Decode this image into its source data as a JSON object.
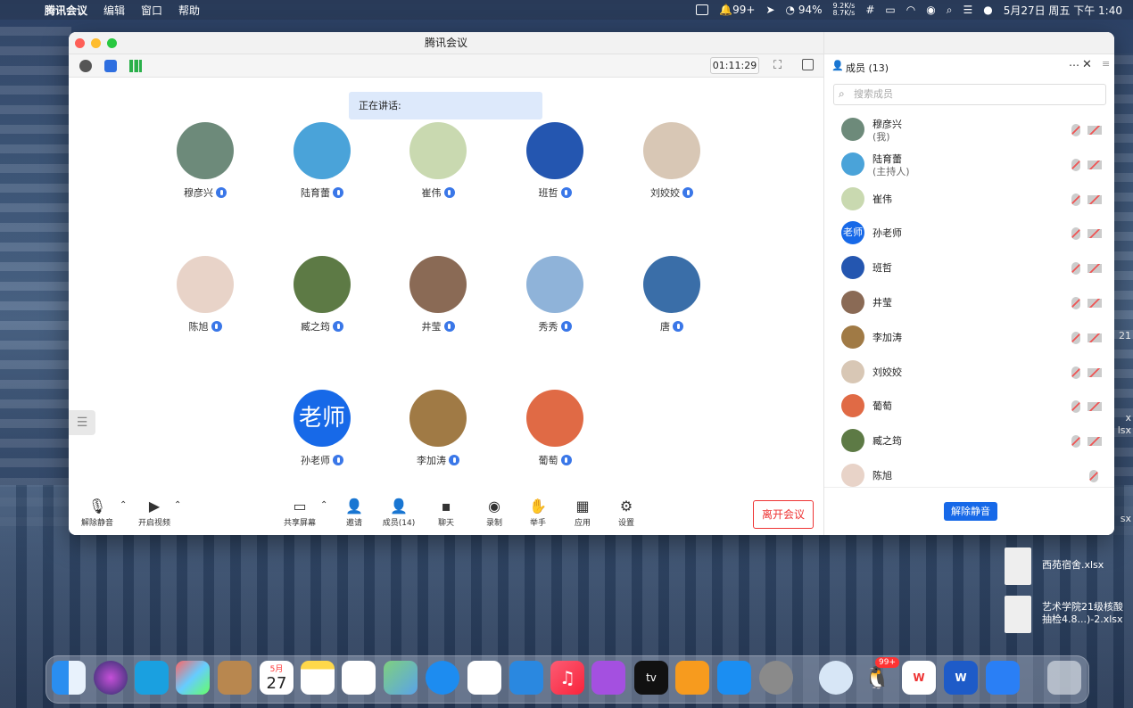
{
  "menubar": {
    "app": "腾讯会议",
    "items": [
      "编辑",
      "窗口",
      "帮助"
    ],
    "notif_count": "99+",
    "battery": "94%",
    "net_up": "9.2K/s",
    "net_down": "8.7K/s",
    "datetime": "5月27日 周五 下午 1:40"
  },
  "window": {
    "title": "腾讯会议",
    "timer": "01:11:29",
    "speaking_label": "正在讲话:"
  },
  "participants": [
    {
      "name": "穆彦兴",
      "color": "#6d8a7a"
    },
    {
      "name": "陆育蕾",
      "color": "#4aa3d9"
    },
    {
      "name": "崔伟",
      "color": "#c9d9b0"
    },
    {
      "name": "班哲",
      "color": "#2456b0"
    },
    {
      "name": "刘姣姣",
      "color": "#d8c7b5"
    },
    {
      "name": "陈旭",
      "color": "#e8d3c8"
    },
    {
      "name": "臧之筠",
      "color": "#5d7a45"
    },
    {
      "name": "井莹",
      "color": "#8a6a55"
    },
    {
      "name": "秀秀",
      "color": "#8fb3d9"
    },
    {
      "name": "唐",
      "color": "#3a6ea8"
    },
    {
      "name": "孙老师",
      "text": "老师",
      "color": "#1769e8"
    },
    {
      "name": "李加涛",
      "color": "#a07a45"
    },
    {
      "name": "葡萄",
      "color": "#e06a45"
    }
  ],
  "bottombar": {
    "unmute": "解除静音",
    "video": "开启视频",
    "share": "共享屏幕",
    "invite": "邀请",
    "members": "成员(14)",
    "chat": "聊天",
    "record": "录制",
    "raise_hand": "举手",
    "apps": "应用",
    "settings": "设置",
    "leave": "离开会议"
  },
  "panel": {
    "title": "成员 (13)",
    "search_placeholder": "搜索成员",
    "unmute_all": "解除静音",
    "members": [
      {
        "name": "穆彦兴",
        "sub": "(我)",
        "color": "#6d8a7a"
      },
      {
        "name": "陆育蕾",
        "sub": "(主持人)",
        "color": "#4aa3d9"
      },
      {
        "name": "崔伟",
        "sub": "",
        "color": "#c9d9b0"
      },
      {
        "name": "孙老师",
        "sub": "",
        "color": "#1769e8",
        "text": "老师"
      },
      {
        "name": "班哲",
        "sub": "",
        "color": "#2456b0"
      },
      {
        "name": "井莹",
        "sub": "",
        "color": "#8a6a55"
      },
      {
        "name": "李加涛",
        "sub": "",
        "color": "#a07a45"
      },
      {
        "name": "刘姣姣",
        "sub": "",
        "color": "#d8c7b5"
      },
      {
        "name": "葡萄",
        "sub": "",
        "color": "#e06a45"
      },
      {
        "name": "臧之筠",
        "sub": "",
        "color": "#5d7a45"
      },
      {
        "name": "陈旭",
        "sub": "",
        "color": "#e8d3c8"
      }
    ]
  },
  "desktop": {
    "file1": "西苑宿舍.xlsx",
    "file2_line1": "艺术学院21级核酸",
    "file2_line2": "抽检4.8...)-2.xlsx",
    "edge_21": "21",
    "edge_x1": "x",
    "edge_x2": "lsx",
    "edge_x3": "sx"
  },
  "dock": {
    "calendar_month": "5月",
    "calendar_day": "27",
    "qq_badge": "99+",
    "tv": "tv"
  }
}
